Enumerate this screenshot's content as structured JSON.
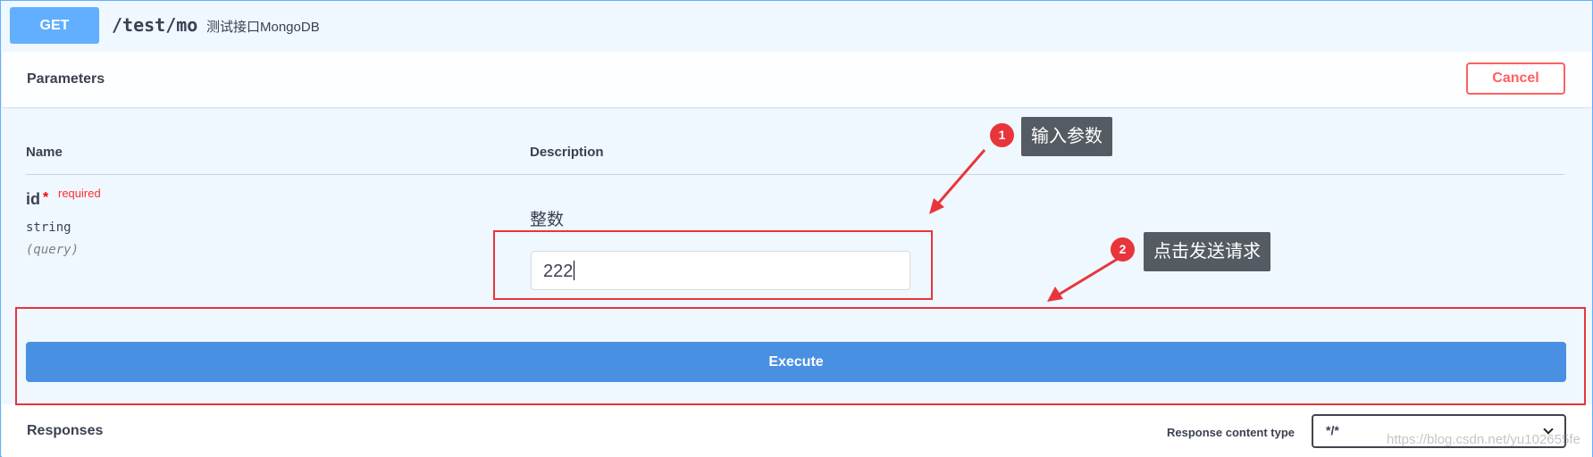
{
  "operation": {
    "method": "GET",
    "path": "/test/mo",
    "description": "测试接口MongoDB",
    "accent_color": "#61affe"
  },
  "parameters": {
    "title": "Parameters",
    "cancel_label": "Cancel",
    "column_name": "Name",
    "column_description": "Description",
    "items": [
      {
        "name": "id",
        "required_mark": "*",
        "required_label": "required",
        "type": "string",
        "location": "(query)",
        "description": "整数",
        "value": "222"
      }
    ]
  },
  "execute": {
    "label": "Execute",
    "color": "#4990e2"
  },
  "responses": {
    "title": "Responses",
    "content_type_label": "Response content type",
    "content_type_value": "*/*"
  },
  "annotations": [
    {
      "number": "1",
      "text": "输入参数"
    },
    {
      "number": "2",
      "text": "点击发送请求"
    }
  ],
  "annotation_color": "#e8353b",
  "watermark": "https://blog.csdn.net/yu102655fe"
}
